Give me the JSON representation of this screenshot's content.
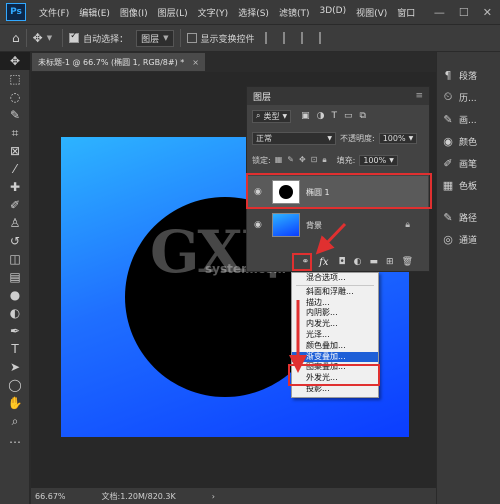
{
  "app": {
    "logo": "Ps"
  },
  "menubar": {
    "items": [
      "文件(F)",
      "编辑(E)",
      "图像(I)",
      "图层(L)",
      "文字(Y)",
      "选择(S)",
      "滤镜(T)",
      "3D(D)",
      "视图(V)",
      "窗口"
    ],
    "window_controls": [
      "—",
      "☐",
      "✕"
    ]
  },
  "optionsbar": {
    "auto_select_label": "自动选择：",
    "auto_select_checked": true,
    "target_value": "图层",
    "show_transform_label": "显示变换控件"
  },
  "document": {
    "tab_title": "未标题-1 @ 66.7% (椭圆 1, RGB/8#) *",
    "close": "×"
  },
  "canvas": {
    "watermark_big": "GXI网",
    "watermark_small": "system.com",
    "colors": {
      "gradient_start": "#2db4ff",
      "gradient_end": "#0b3dff",
      "circle": "#000000"
    }
  },
  "statusbar": {
    "zoom": "66.67%",
    "doc_info": "文档:1.20M/820.3K"
  },
  "toolbar": {
    "tools": [
      "move-icon",
      "marquee-icon",
      "lasso-icon",
      "quick-select-icon",
      "crop-icon",
      "frame-icon",
      "eyedropper-icon",
      "healing-icon",
      "brush-icon",
      "stamp-icon",
      "history-brush-icon",
      "eraser-icon",
      "gradient-icon",
      "blur-icon",
      "dodge-icon",
      "pen-icon",
      "type-icon",
      "path-select-icon",
      "ellipse-icon",
      "hand-icon",
      "zoom-icon",
      "more-icon"
    ]
  },
  "dock": {
    "items": [
      {
        "icon": "paragraph-icon",
        "label": "段落"
      },
      {
        "icon": "history-icon",
        "label": "历..."
      },
      {
        "icon": "brush-panel-icon",
        "label": "画..."
      },
      {
        "icon": "color-icon",
        "label": "颜色"
      },
      {
        "icon": "swatches-icon",
        "label": "画笔"
      },
      {
        "icon": "swatches-grid-icon",
        "label": "色板"
      },
      {
        "icon": "paths-icon",
        "label": "路径"
      },
      {
        "icon": "channels-icon",
        "label": "通道"
      }
    ]
  },
  "layers_panel": {
    "title": "图层",
    "filter_kind": "类型",
    "blend_mode": "正常",
    "opacity_label": "不透明度:",
    "opacity_value": "100%",
    "lock_label": "锁定:",
    "fill_label": "填充:",
    "fill_value": "100%",
    "layers": [
      {
        "name": "椭圆 1",
        "selected": true,
        "type": "shape"
      },
      {
        "name": "背景",
        "selected": false,
        "type": "background",
        "locked": true
      }
    ],
    "footer_fx": "fx"
  },
  "fx_menu": {
    "items": [
      "混合选项...",
      "斜面和浮雕...",
      "描边...",
      "内阴影...",
      "内发光...",
      "光泽...",
      "颜色叠加...",
      "渐变叠加...",
      "图案叠加...",
      "外发光...",
      "投影..."
    ],
    "highlighted_index": 7
  },
  "annotations": {
    "color": "#e03030"
  }
}
